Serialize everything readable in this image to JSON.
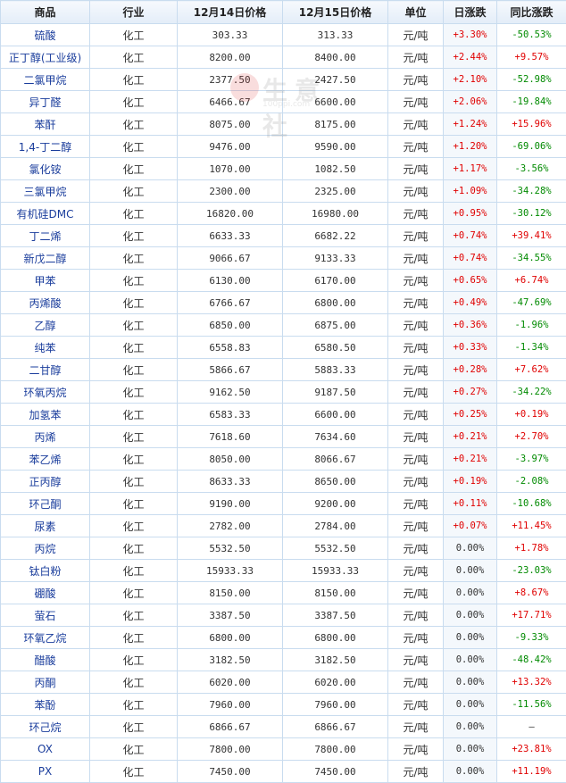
{
  "headers": [
    "商品",
    "行业",
    "12月14日价格",
    "12月15日价格",
    "单位",
    "日涨跌",
    "同比涨跌"
  ],
  "watermark": {
    "text": "生意社",
    "url": "100ppi.com"
  },
  "rows": [
    {
      "name": "硫酸",
      "industry": "化工",
      "p1": "303.33",
      "p2": "313.33",
      "unit": "元/吨",
      "chg": "+3.30%",
      "yoy": "-50.53%"
    },
    {
      "name": "正丁醇(工业级)",
      "industry": "化工",
      "p1": "8200.00",
      "p2": "8400.00",
      "unit": "元/吨",
      "chg": "+2.44%",
      "yoy": "+9.57%"
    },
    {
      "name": "二氯甲烷",
      "industry": "化工",
      "p1": "2377.50",
      "p2": "2427.50",
      "unit": "元/吨",
      "chg": "+2.10%",
      "yoy": "-52.98%"
    },
    {
      "name": "异丁醛",
      "industry": "化工",
      "p1": "6466.67",
      "p2": "6600.00",
      "unit": "元/吨",
      "chg": "+2.06%",
      "yoy": "-19.84%"
    },
    {
      "name": "苯酐",
      "industry": "化工",
      "p1": "8075.00",
      "p2": "8175.00",
      "unit": "元/吨",
      "chg": "+1.24%",
      "yoy": "+15.96%"
    },
    {
      "name": "1,4-丁二醇",
      "industry": "化工",
      "p1": "9476.00",
      "p2": "9590.00",
      "unit": "元/吨",
      "chg": "+1.20%",
      "yoy": "-69.06%"
    },
    {
      "name": "氯化铵",
      "industry": "化工",
      "p1": "1070.00",
      "p2": "1082.50",
      "unit": "元/吨",
      "chg": "+1.17%",
      "yoy": "-3.56%"
    },
    {
      "name": "三氯甲烷",
      "industry": "化工",
      "p1": "2300.00",
      "p2": "2325.00",
      "unit": "元/吨",
      "chg": "+1.09%",
      "yoy": "-34.28%"
    },
    {
      "name": "有机硅DMC",
      "industry": "化工",
      "p1": "16820.00",
      "p2": "16980.00",
      "unit": "元/吨",
      "chg": "+0.95%",
      "yoy": "-30.12%"
    },
    {
      "name": "丁二烯",
      "industry": "化工",
      "p1": "6633.33",
      "p2": "6682.22",
      "unit": "元/吨",
      "chg": "+0.74%",
      "yoy": "+39.41%"
    },
    {
      "name": "新戊二醇",
      "industry": "化工",
      "p1": "9066.67",
      "p2": "9133.33",
      "unit": "元/吨",
      "chg": "+0.74%",
      "yoy": "-34.55%"
    },
    {
      "name": "甲苯",
      "industry": "化工",
      "p1": "6130.00",
      "p2": "6170.00",
      "unit": "元/吨",
      "chg": "+0.65%",
      "yoy": "+6.74%"
    },
    {
      "name": "丙烯酸",
      "industry": "化工",
      "p1": "6766.67",
      "p2": "6800.00",
      "unit": "元/吨",
      "chg": "+0.49%",
      "yoy": "-47.69%"
    },
    {
      "name": "乙醇",
      "industry": "化工",
      "p1": "6850.00",
      "p2": "6875.00",
      "unit": "元/吨",
      "chg": "+0.36%",
      "yoy": "-1.96%"
    },
    {
      "name": "纯苯",
      "industry": "化工",
      "p1": "6558.83",
      "p2": "6580.50",
      "unit": "元/吨",
      "chg": "+0.33%",
      "yoy": "-1.34%"
    },
    {
      "name": "二甘醇",
      "industry": "化工",
      "p1": "5866.67",
      "p2": "5883.33",
      "unit": "元/吨",
      "chg": "+0.28%",
      "yoy": "+7.62%"
    },
    {
      "name": "环氧丙烷",
      "industry": "化工",
      "p1": "9162.50",
      "p2": "9187.50",
      "unit": "元/吨",
      "chg": "+0.27%",
      "yoy": "-34.22%"
    },
    {
      "name": "加氢苯",
      "industry": "化工",
      "p1": "6583.33",
      "p2": "6600.00",
      "unit": "元/吨",
      "chg": "+0.25%",
      "yoy": "+0.19%"
    },
    {
      "name": "丙烯",
      "industry": "化工",
      "p1": "7618.60",
      "p2": "7634.60",
      "unit": "元/吨",
      "chg": "+0.21%",
      "yoy": "+2.70%"
    },
    {
      "name": "苯乙烯",
      "industry": "化工",
      "p1": "8050.00",
      "p2": "8066.67",
      "unit": "元/吨",
      "chg": "+0.21%",
      "yoy": "-3.97%"
    },
    {
      "name": "正丙醇",
      "industry": "化工",
      "p1": "8633.33",
      "p2": "8650.00",
      "unit": "元/吨",
      "chg": "+0.19%",
      "yoy": "-2.08%"
    },
    {
      "name": "环己酮",
      "industry": "化工",
      "p1": "9190.00",
      "p2": "9200.00",
      "unit": "元/吨",
      "chg": "+0.11%",
      "yoy": "-10.68%"
    },
    {
      "name": "尿素",
      "industry": "化工",
      "p1": "2782.00",
      "p2": "2784.00",
      "unit": "元/吨",
      "chg": "+0.07%",
      "yoy": "+11.45%"
    },
    {
      "name": "丙烷",
      "industry": "化工",
      "p1": "5532.50",
      "p2": "5532.50",
      "unit": "元/吨",
      "chg": "0.00%",
      "yoy": "+1.78%"
    },
    {
      "name": "钛白粉",
      "industry": "化工",
      "p1": "15933.33",
      "p2": "15933.33",
      "unit": "元/吨",
      "chg": "0.00%",
      "yoy": "-23.03%"
    },
    {
      "name": "硼酸",
      "industry": "化工",
      "p1": "8150.00",
      "p2": "8150.00",
      "unit": "元/吨",
      "chg": "0.00%",
      "yoy": "+8.67%"
    },
    {
      "name": "萤石",
      "industry": "化工",
      "p1": "3387.50",
      "p2": "3387.50",
      "unit": "元/吨",
      "chg": "0.00%",
      "yoy": "+17.71%"
    },
    {
      "name": "环氧乙烷",
      "industry": "化工",
      "p1": "6800.00",
      "p2": "6800.00",
      "unit": "元/吨",
      "chg": "0.00%",
      "yoy": "-9.33%"
    },
    {
      "name": "醋酸",
      "industry": "化工",
      "p1": "3182.50",
      "p2": "3182.50",
      "unit": "元/吨",
      "chg": "0.00%",
      "yoy": "-48.42%"
    },
    {
      "name": "丙酮",
      "industry": "化工",
      "p1": "6020.00",
      "p2": "6020.00",
      "unit": "元/吨",
      "chg": "0.00%",
      "yoy": "+13.32%"
    },
    {
      "name": "苯酚",
      "industry": "化工",
      "p1": "7960.00",
      "p2": "7960.00",
      "unit": "元/吨",
      "chg": "0.00%",
      "yoy": "-11.56%"
    },
    {
      "name": "环己烷",
      "industry": "化工",
      "p1": "6866.67",
      "p2": "6866.67",
      "unit": "元/吨",
      "chg": "0.00%",
      "yoy": "—"
    },
    {
      "name": "OX",
      "industry": "化工",
      "p1": "7800.00",
      "p2": "7800.00",
      "unit": "元/吨",
      "chg": "0.00%",
      "yoy": "+23.81%"
    },
    {
      "name": "PX",
      "industry": "化工",
      "p1": "7450.00",
      "p2": "7450.00",
      "unit": "元/吨",
      "chg": "0.00%",
      "yoy": "+11.19%"
    }
  ]
}
